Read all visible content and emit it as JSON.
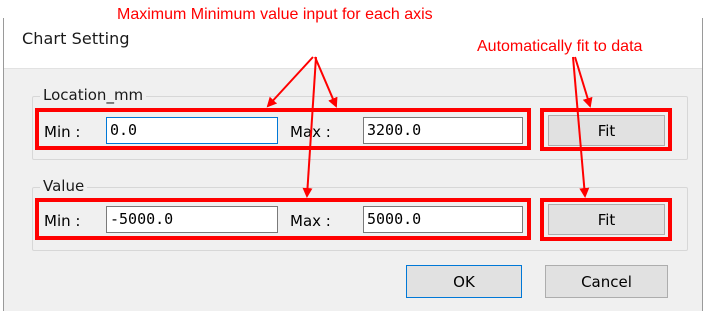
{
  "window": {
    "title": "Chart Setting"
  },
  "location_group": {
    "label": "Location_mm",
    "min_label": "Min :",
    "min_value": "0.0",
    "max_label": "Max :",
    "max_value": "3200.0",
    "fit_label": "Fit"
  },
  "value_group": {
    "label": "Value",
    "min_label": "Min :",
    "min_value": "-5000.0",
    "max_label": "Max :",
    "max_value": "5000.0",
    "fit_label": "Fit"
  },
  "buttons": {
    "ok_label": "OK",
    "cancel_label": "Cancel"
  },
  "annotations": {
    "minmax_note": "Maximum Minimum value input for each axis",
    "fit_note": "Automatically fit to data",
    "color": "#ff0000"
  }
}
